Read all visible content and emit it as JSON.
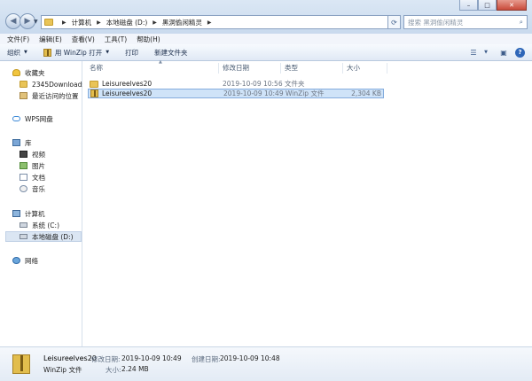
{
  "window": {
    "minimize_label": "–",
    "maximize_label": "□",
    "close_label": "✕"
  },
  "address": {
    "crumbs": [
      "计算机",
      "本地磁盘 (D:)",
      "黑洞偷闲精灵"
    ]
  },
  "search": {
    "placeholder": "搜索 黑洞偷闲精灵"
  },
  "menu": {
    "file": "文件(F)",
    "edit": "编辑(E)",
    "view": "查看(V)",
    "tools": "工具(T)",
    "help": "帮助(H)"
  },
  "toolbar": {
    "organize": "组织",
    "open_with": "用 WinZip 打开",
    "print": "打印",
    "new_folder": "新建文件夹"
  },
  "nav": {
    "favorites": "收藏夹",
    "downloads": "2345Downloads",
    "recent": "最近访问的位置",
    "wps": "WPS网盘",
    "library": "库",
    "video": "视频",
    "pictures": "图片",
    "documents": "文档",
    "music": "音乐",
    "computer": "计算机",
    "drive_c": "系统 (C:)",
    "drive_d": "本地磁盘 (D:)",
    "network": "网络"
  },
  "columns": {
    "name": "名称",
    "modified": "修改日期",
    "type": "类型",
    "size": "大小"
  },
  "files": [
    {
      "name": "Leisureelves20",
      "modified": "2019-10-09 10:56",
      "type": "文件夹",
      "size": ""
    },
    {
      "name": "Leisureelves20",
      "modified": "2019-10-09 10:49",
      "type": "WinZip 文件",
      "size": "2,304 KB"
    }
  ],
  "details": {
    "name": "Leisureelves20",
    "type": "WinZip 文件",
    "modified_label": "修改日期:",
    "modified_value": "2019-10-09 10:49",
    "created_label": "创建日期:",
    "created_value": "2019-10-09 10:48",
    "size_label": "大小:",
    "size_value": "2.24 MB"
  }
}
